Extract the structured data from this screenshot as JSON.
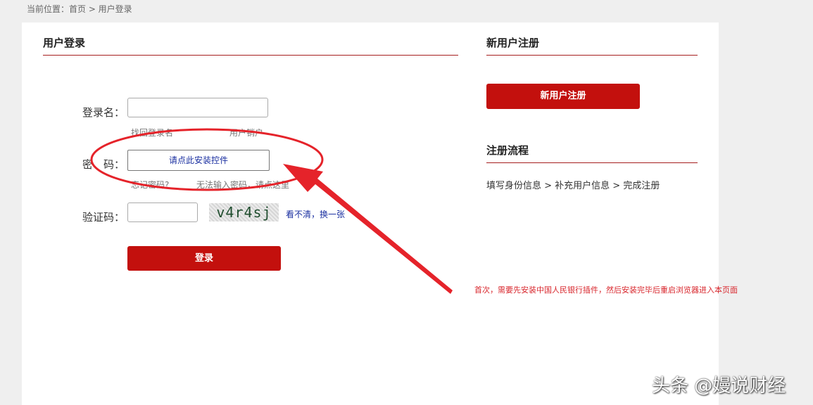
{
  "breadcrumb": {
    "text": "当前位置：首页 > 用户登录"
  },
  "login": {
    "title": "用户登录",
    "username_label": "登录名：",
    "find_username": "找回登录名",
    "cancel_user": "用户销户",
    "password_label": "密　码：",
    "install_control": "请点此安装控件",
    "forgot_password": "忘记密码?",
    "cannot_input": "无法输入密码，请点这里",
    "captcha_label": "验证码：",
    "captcha_text": "v4r4sj",
    "captcha_refresh": "看不清，换一张",
    "submit": "登录"
  },
  "register": {
    "title": "新用户注册",
    "button": "新用户注册",
    "flow_title": "注册流程",
    "flow_steps": "填写身份信息 > 补充用户信息 > 完成注册"
  },
  "annotation": {
    "text": "首次，需要先安装中国人民银行插件，然后安装完毕后重启浏览器进入本页面",
    "color": "#d8262c"
  },
  "watermark": {
    "text": "头条 @嫚说财经"
  },
  "colors": {
    "accent": "#c3100d",
    "title_line": "#a61e1e",
    "link_blue": "#1a2fa0"
  }
}
